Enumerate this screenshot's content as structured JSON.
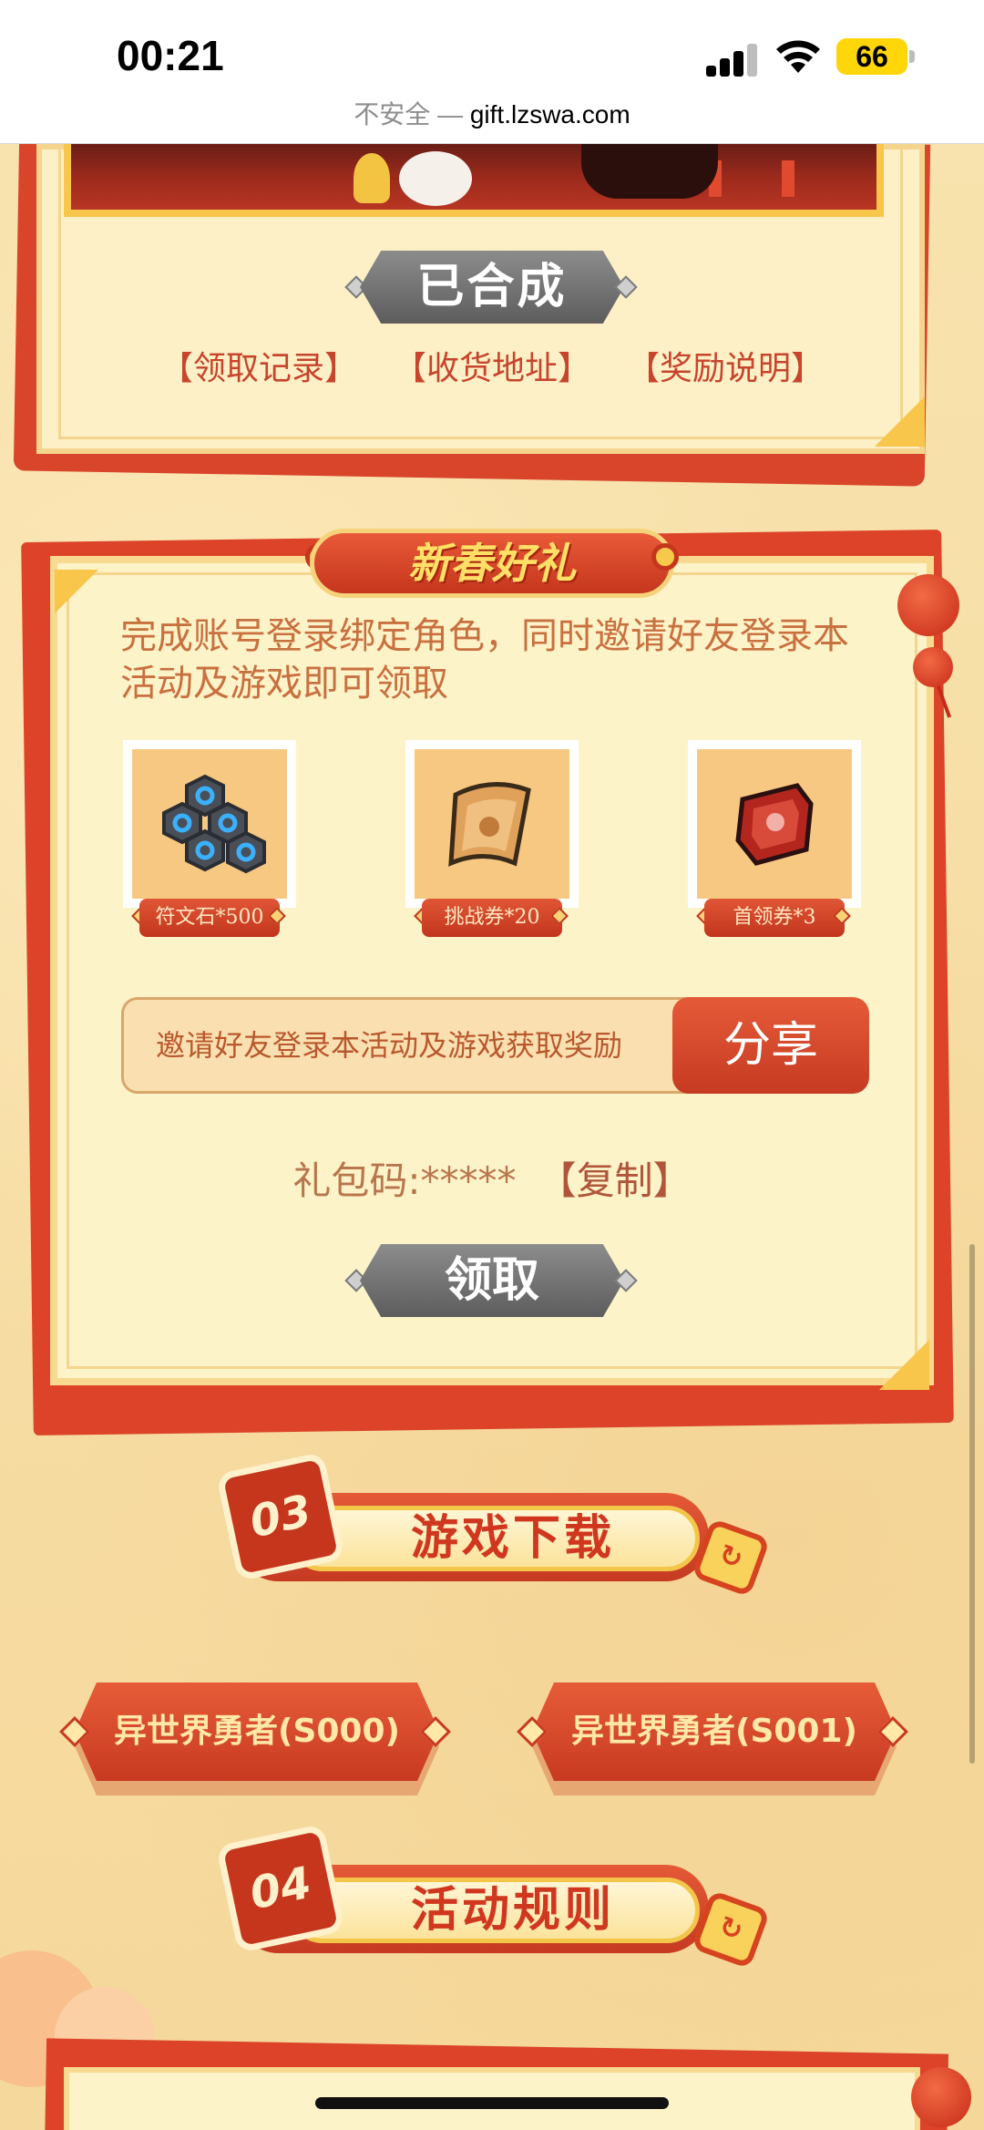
{
  "status_bar": {
    "time": "00:21",
    "battery": "66",
    "icons": [
      "signal-icon",
      "wifi-icon",
      "battery-icon"
    ]
  },
  "url_bar": {
    "insecure_label": "不安全 —",
    "domain": "gift.lzswa.com"
  },
  "top_panel": {
    "composed_button": "已合成",
    "links": [
      "【领取记录】",
      "【收货地址】",
      "【奖励说明】"
    ]
  },
  "gift_panel": {
    "title": "新春好礼",
    "description": "完成账号登录绑定角色，同时邀请好友登录本活动及游戏即可领取",
    "rewards": [
      {
        "label": "符文石*500",
        "icon": "rune-stone-icon"
      },
      {
        "label": "挑战券*20",
        "icon": "challenge-ticket-icon"
      },
      {
        "label": "首领券*3",
        "icon": "boss-ticket-icon"
      }
    ],
    "invite_text": "邀请好友登录本活动及游戏获取奖励",
    "share_button": "分享",
    "gift_code_label": "礼包码:*****",
    "copy_link": "【复制】",
    "claim_button": "领取"
  },
  "sections": {
    "download": {
      "number": "03",
      "title": "游戏下载"
    },
    "rules": {
      "number": "04",
      "title": "活动规则"
    }
  },
  "download_buttons": [
    "异世界勇者(S000)",
    "异世界勇者(S001)"
  ],
  "colors": {
    "accent_red": "#c5361d",
    "panel_cream": "#fdf3c9",
    "background": "#f7dfa6",
    "gold": "#f7c64a"
  }
}
